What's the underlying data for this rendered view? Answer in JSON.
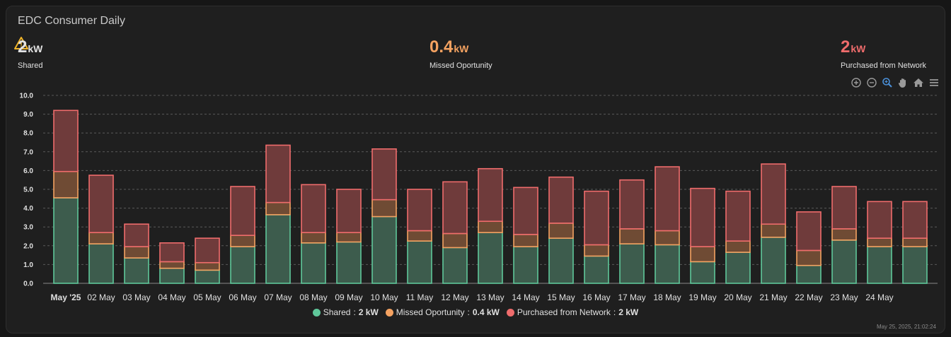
{
  "card": {
    "title": "EDC Consumer Daily"
  },
  "stats": [
    {
      "value": "2",
      "unit": "kW",
      "label": "Shared",
      "color": "#e1e1e1"
    },
    {
      "value": "0.4",
      "unit": "kW",
      "label": "Missed Oportunity",
      "color": "#f4a261"
    },
    {
      "value": "2",
      "unit": "kW",
      "label": "Purchased from Network",
      "color": "#ef6c6c"
    }
  ],
  "toolbar": [
    "zoom-in-icon",
    "zoom-out-icon",
    "zoom-select-icon",
    "pan-hand-icon",
    "home-icon",
    "menu-icon"
  ],
  "legend": [
    {
      "name": "Shared",
      "value": "2 kW",
      "color": "#5fc79a"
    },
    {
      "name": "Missed Oportunity",
      "value": "0.4 kW",
      "color": "#f4a261"
    },
    {
      "name": "Purchased from Network",
      "value": "2 kW",
      "color": "#ef6c6c"
    }
  ],
  "footer": {
    "timestamp": "May 25, 2025, 21:02:24"
  },
  "chart_data": {
    "type": "bar",
    "stacked": true,
    "categories": [
      "May '25",
      "02 May",
      "03 May",
      "04 May",
      "05 May",
      "06 May",
      "07 May",
      "08 May",
      "09 May",
      "10 May",
      "11 May",
      "12 May",
      "13 May",
      "14 May",
      "15 May",
      "16 May",
      "17 May",
      "18 May",
      "19 May",
      "20 May",
      "21 May",
      "22 May",
      "23 May",
      "24 May",
      ""
    ],
    "series": [
      {
        "name": "Shared",
        "color": "#5fc79a",
        "values": [
          4.55,
          2.1,
          1.35,
          0.8,
          0.7,
          1.95,
          3.65,
          2.15,
          2.2,
          3.55,
          2.25,
          1.9,
          2.7,
          1.95,
          2.4,
          1.45,
          2.1,
          2.05,
          1.15,
          1.65,
          2.45,
          0.95,
          2.3,
          1.95,
          1.95
        ]
      },
      {
        "name": "Missed Oportunity",
        "color": "#f4a261",
        "values": [
          1.4,
          0.6,
          0.6,
          0.35,
          0.4,
          0.6,
          0.65,
          0.55,
          0.5,
          0.9,
          0.55,
          0.75,
          0.6,
          0.65,
          0.8,
          0.6,
          0.8,
          0.75,
          0.8,
          0.6,
          0.7,
          0.8,
          0.6,
          0.45,
          0.45
        ]
      },
      {
        "name": "Purchased from Network",
        "color": "#ef6c6c",
        "values": [
          3.25,
          3.05,
          1.2,
          1.0,
          1.3,
          2.6,
          3.05,
          2.55,
          2.3,
          2.7,
          2.2,
          2.75,
          2.8,
          2.5,
          2.45,
          2.85,
          2.6,
          3.4,
          3.1,
          2.65,
          3.2,
          2.05,
          2.25,
          1.95,
          1.95
        ]
      }
    ],
    "ylim": [
      0,
      10
    ],
    "yticks": [
      "0.0",
      "1.0",
      "2.0",
      "3.0",
      "4.0",
      "5.0",
      "6.0",
      "7.0",
      "8.0",
      "9.0",
      "10.0"
    ],
    "grid": true,
    "legend_position": "bottom"
  }
}
